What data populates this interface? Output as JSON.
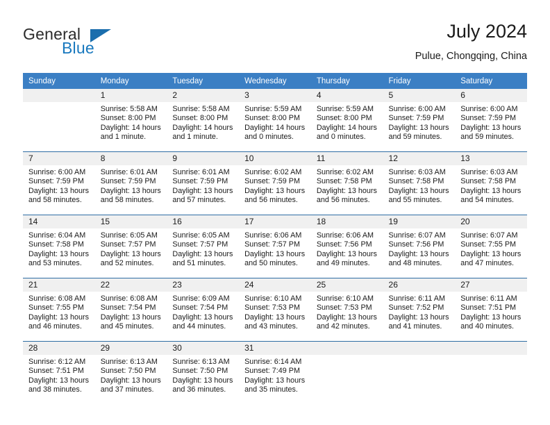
{
  "brand": {
    "name_part1": "General",
    "name_part2": "Blue",
    "accent_color": "#1878be",
    "triangle_color": "#1b6ead"
  },
  "header": {
    "title": "July 2024",
    "location": "Pulue, Chongqing, China"
  },
  "calendar": {
    "header_bg": "#3b7fc4",
    "row_border_color": "#2e6da4",
    "daynum_band_bg": "#f0f0f0",
    "weekday_headers": [
      "Sunday",
      "Monday",
      "Tuesday",
      "Wednesday",
      "Thursday",
      "Friday",
      "Saturday"
    ],
    "weeks": [
      [
        {
          "day": "",
          "sunrise": "",
          "sunset": "",
          "daylight_line1": "",
          "daylight_line2": ""
        },
        {
          "day": "1",
          "sunrise": "Sunrise: 5:58 AM",
          "sunset": "Sunset: 8:00 PM",
          "daylight_line1": "Daylight: 14 hours",
          "daylight_line2": "and 1 minute."
        },
        {
          "day": "2",
          "sunrise": "Sunrise: 5:58 AM",
          "sunset": "Sunset: 8:00 PM",
          "daylight_line1": "Daylight: 14 hours",
          "daylight_line2": "and 1 minute."
        },
        {
          "day": "3",
          "sunrise": "Sunrise: 5:59 AM",
          "sunset": "Sunset: 8:00 PM",
          "daylight_line1": "Daylight: 14 hours",
          "daylight_line2": "and 0 minutes."
        },
        {
          "day": "4",
          "sunrise": "Sunrise: 5:59 AM",
          "sunset": "Sunset: 8:00 PM",
          "daylight_line1": "Daylight: 14 hours",
          "daylight_line2": "and 0 minutes."
        },
        {
          "day": "5",
          "sunrise": "Sunrise: 6:00 AM",
          "sunset": "Sunset: 7:59 PM",
          "daylight_line1": "Daylight: 13 hours",
          "daylight_line2": "and 59 minutes."
        },
        {
          "day": "6",
          "sunrise": "Sunrise: 6:00 AM",
          "sunset": "Sunset: 7:59 PM",
          "daylight_line1": "Daylight: 13 hours",
          "daylight_line2": "and 59 minutes."
        }
      ],
      [
        {
          "day": "7",
          "sunrise": "Sunrise: 6:00 AM",
          "sunset": "Sunset: 7:59 PM",
          "daylight_line1": "Daylight: 13 hours",
          "daylight_line2": "and 58 minutes."
        },
        {
          "day": "8",
          "sunrise": "Sunrise: 6:01 AM",
          "sunset": "Sunset: 7:59 PM",
          "daylight_line1": "Daylight: 13 hours",
          "daylight_line2": "and 58 minutes."
        },
        {
          "day": "9",
          "sunrise": "Sunrise: 6:01 AM",
          "sunset": "Sunset: 7:59 PM",
          "daylight_line1": "Daylight: 13 hours",
          "daylight_line2": "and 57 minutes."
        },
        {
          "day": "10",
          "sunrise": "Sunrise: 6:02 AM",
          "sunset": "Sunset: 7:59 PM",
          "daylight_line1": "Daylight: 13 hours",
          "daylight_line2": "and 56 minutes."
        },
        {
          "day": "11",
          "sunrise": "Sunrise: 6:02 AM",
          "sunset": "Sunset: 7:58 PM",
          "daylight_line1": "Daylight: 13 hours",
          "daylight_line2": "and 56 minutes."
        },
        {
          "day": "12",
          "sunrise": "Sunrise: 6:03 AM",
          "sunset": "Sunset: 7:58 PM",
          "daylight_line1": "Daylight: 13 hours",
          "daylight_line2": "and 55 minutes."
        },
        {
          "day": "13",
          "sunrise": "Sunrise: 6:03 AM",
          "sunset": "Sunset: 7:58 PM",
          "daylight_line1": "Daylight: 13 hours",
          "daylight_line2": "and 54 minutes."
        }
      ],
      [
        {
          "day": "14",
          "sunrise": "Sunrise: 6:04 AM",
          "sunset": "Sunset: 7:58 PM",
          "daylight_line1": "Daylight: 13 hours",
          "daylight_line2": "and 53 minutes."
        },
        {
          "day": "15",
          "sunrise": "Sunrise: 6:05 AM",
          "sunset": "Sunset: 7:57 PM",
          "daylight_line1": "Daylight: 13 hours",
          "daylight_line2": "and 52 minutes."
        },
        {
          "day": "16",
          "sunrise": "Sunrise: 6:05 AM",
          "sunset": "Sunset: 7:57 PM",
          "daylight_line1": "Daylight: 13 hours",
          "daylight_line2": "and 51 minutes."
        },
        {
          "day": "17",
          "sunrise": "Sunrise: 6:06 AM",
          "sunset": "Sunset: 7:57 PM",
          "daylight_line1": "Daylight: 13 hours",
          "daylight_line2": "and 50 minutes."
        },
        {
          "day": "18",
          "sunrise": "Sunrise: 6:06 AM",
          "sunset": "Sunset: 7:56 PM",
          "daylight_line1": "Daylight: 13 hours",
          "daylight_line2": "and 49 minutes."
        },
        {
          "day": "19",
          "sunrise": "Sunrise: 6:07 AM",
          "sunset": "Sunset: 7:56 PM",
          "daylight_line1": "Daylight: 13 hours",
          "daylight_line2": "and 48 minutes."
        },
        {
          "day": "20",
          "sunrise": "Sunrise: 6:07 AM",
          "sunset": "Sunset: 7:55 PM",
          "daylight_line1": "Daylight: 13 hours",
          "daylight_line2": "and 47 minutes."
        }
      ],
      [
        {
          "day": "21",
          "sunrise": "Sunrise: 6:08 AM",
          "sunset": "Sunset: 7:55 PM",
          "daylight_line1": "Daylight: 13 hours",
          "daylight_line2": "and 46 minutes."
        },
        {
          "day": "22",
          "sunrise": "Sunrise: 6:08 AM",
          "sunset": "Sunset: 7:54 PM",
          "daylight_line1": "Daylight: 13 hours",
          "daylight_line2": "and 45 minutes."
        },
        {
          "day": "23",
          "sunrise": "Sunrise: 6:09 AM",
          "sunset": "Sunset: 7:54 PM",
          "daylight_line1": "Daylight: 13 hours",
          "daylight_line2": "and 44 minutes."
        },
        {
          "day": "24",
          "sunrise": "Sunrise: 6:10 AM",
          "sunset": "Sunset: 7:53 PM",
          "daylight_line1": "Daylight: 13 hours",
          "daylight_line2": "and 43 minutes."
        },
        {
          "day": "25",
          "sunrise": "Sunrise: 6:10 AM",
          "sunset": "Sunset: 7:53 PM",
          "daylight_line1": "Daylight: 13 hours",
          "daylight_line2": "and 42 minutes."
        },
        {
          "day": "26",
          "sunrise": "Sunrise: 6:11 AM",
          "sunset": "Sunset: 7:52 PM",
          "daylight_line1": "Daylight: 13 hours",
          "daylight_line2": "and 41 minutes."
        },
        {
          "day": "27",
          "sunrise": "Sunrise: 6:11 AM",
          "sunset": "Sunset: 7:51 PM",
          "daylight_line1": "Daylight: 13 hours",
          "daylight_line2": "and 40 minutes."
        }
      ],
      [
        {
          "day": "28",
          "sunrise": "Sunrise: 6:12 AM",
          "sunset": "Sunset: 7:51 PM",
          "daylight_line1": "Daylight: 13 hours",
          "daylight_line2": "and 38 minutes."
        },
        {
          "day": "29",
          "sunrise": "Sunrise: 6:13 AM",
          "sunset": "Sunset: 7:50 PM",
          "daylight_line1": "Daylight: 13 hours",
          "daylight_line2": "and 37 minutes."
        },
        {
          "day": "30",
          "sunrise": "Sunrise: 6:13 AM",
          "sunset": "Sunset: 7:50 PM",
          "daylight_line1": "Daylight: 13 hours",
          "daylight_line2": "and 36 minutes."
        },
        {
          "day": "31",
          "sunrise": "Sunrise: 6:14 AM",
          "sunset": "Sunset: 7:49 PM",
          "daylight_line1": "Daylight: 13 hours",
          "daylight_line2": "and 35 minutes."
        },
        {
          "day": "",
          "sunrise": "",
          "sunset": "",
          "daylight_line1": "",
          "daylight_line2": ""
        },
        {
          "day": "",
          "sunrise": "",
          "sunset": "",
          "daylight_line1": "",
          "daylight_line2": ""
        },
        {
          "day": "",
          "sunrise": "",
          "sunset": "",
          "daylight_line1": "",
          "daylight_line2": ""
        }
      ]
    ]
  }
}
